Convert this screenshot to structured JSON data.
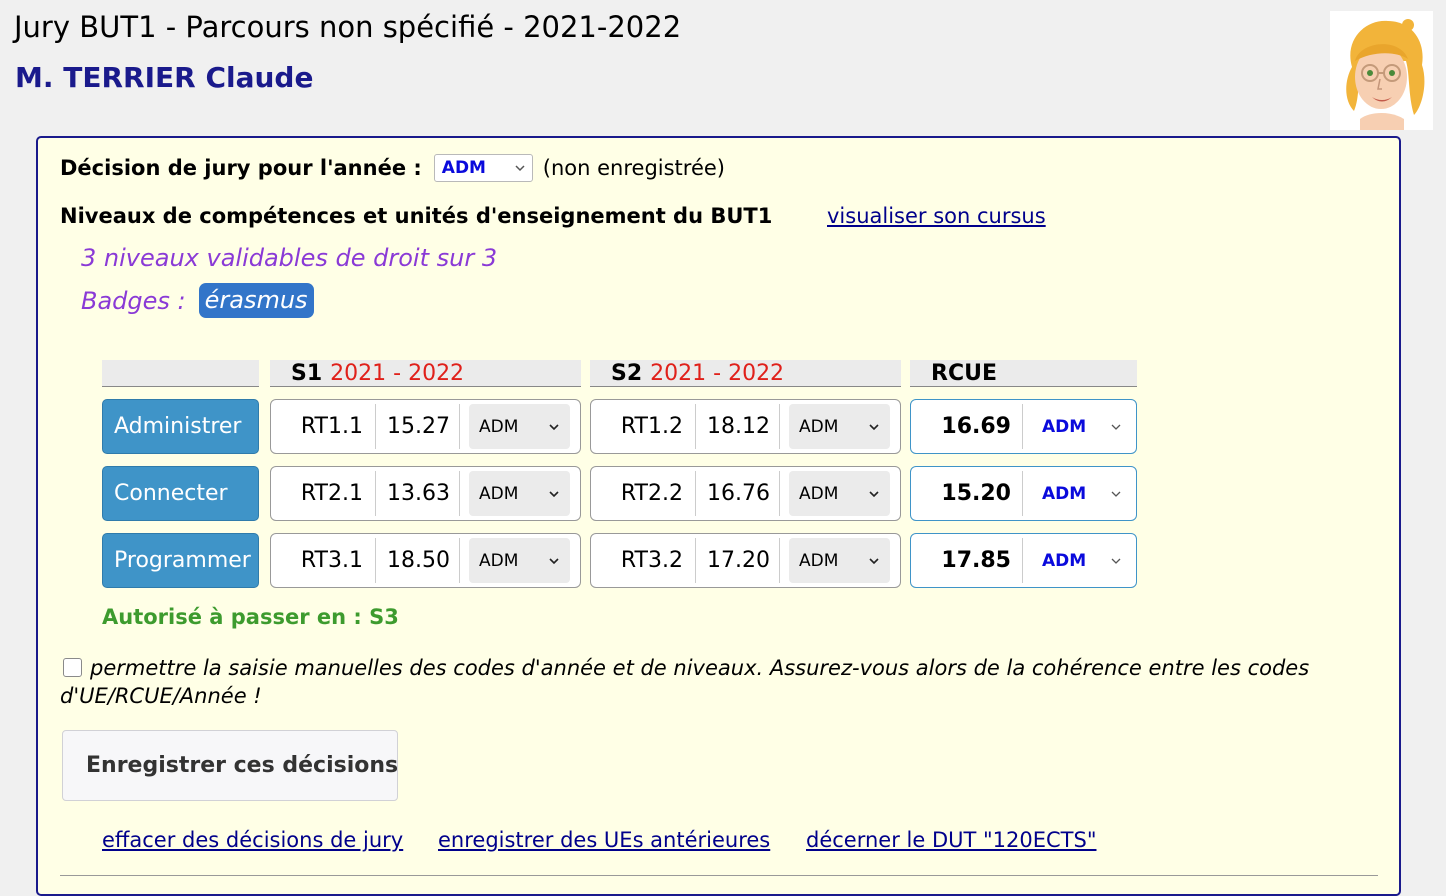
{
  "header": {
    "title": "Jury BUT1 - Parcours non spécifié - 2021-2022",
    "student": "M. TERRIER Claude"
  },
  "decision": {
    "label": "Décision de jury pour l'année :",
    "selected": "ADM",
    "status": "(non enregistrée)"
  },
  "niveaux": {
    "title": "Niveaux de compétences et unités d'enseignement du BUT1",
    "cursus_link": "visualiser son cursus",
    "validables": "3 niveaux validables de droit sur 3",
    "badges_label": "Badges :",
    "badges": [
      "érasmus"
    ]
  },
  "columns": {
    "s1": {
      "label": "S1",
      "year": "2021 - 2022"
    },
    "s2": {
      "label": "S2",
      "year": "2021 - 2022"
    },
    "rcue": {
      "label": "RCUE"
    }
  },
  "rows": [
    {
      "name": "Administrer",
      "s1": {
        "code": "RT1.1",
        "moy": "15.27",
        "dec": "ADM"
      },
      "s2": {
        "code": "RT1.2",
        "moy": "18.12",
        "dec": "ADM"
      },
      "rcue": {
        "moy": "16.69",
        "dec": "ADM"
      }
    },
    {
      "name": "Connecter",
      "s1": {
        "code": "RT2.1",
        "moy": "13.63",
        "dec": "ADM"
      },
      "s2": {
        "code": "RT2.2",
        "moy": "16.76",
        "dec": "ADM"
      },
      "rcue": {
        "moy": "15.20",
        "dec": "ADM"
      }
    },
    {
      "name": "Programmer",
      "s1": {
        "code": "RT3.1",
        "moy": "18.50",
        "dec": "ADM"
      },
      "s2": {
        "code": "RT3.2",
        "moy": "17.20",
        "dec": "ADM"
      },
      "rcue": {
        "moy": "17.85",
        "dec": "ADM"
      }
    }
  ],
  "autorise": "Autorisé à passer en : S3",
  "manual": {
    "checked": false,
    "text": "permettre la saisie manuelles des codes d'année et de niveaux. Assurez-vous alors de la cohérence entre les codes d'UE/RCUE/Année !"
  },
  "actions": {
    "save": "Enregistrer ces décisions",
    "links": [
      "effacer des décisions de jury",
      "enregistrer des UEs antérieures",
      "décerner le DUT \"120ECTS\""
    ]
  },
  "colors": {
    "accent": "#1a1a8c",
    "ue_button": "#3f94c8",
    "badge": "#3275c9",
    "year_red": "#e0201a",
    "green": "#3d9b2e",
    "purple": "#8a3ad6",
    "panel_bg": "#ffffe6"
  }
}
